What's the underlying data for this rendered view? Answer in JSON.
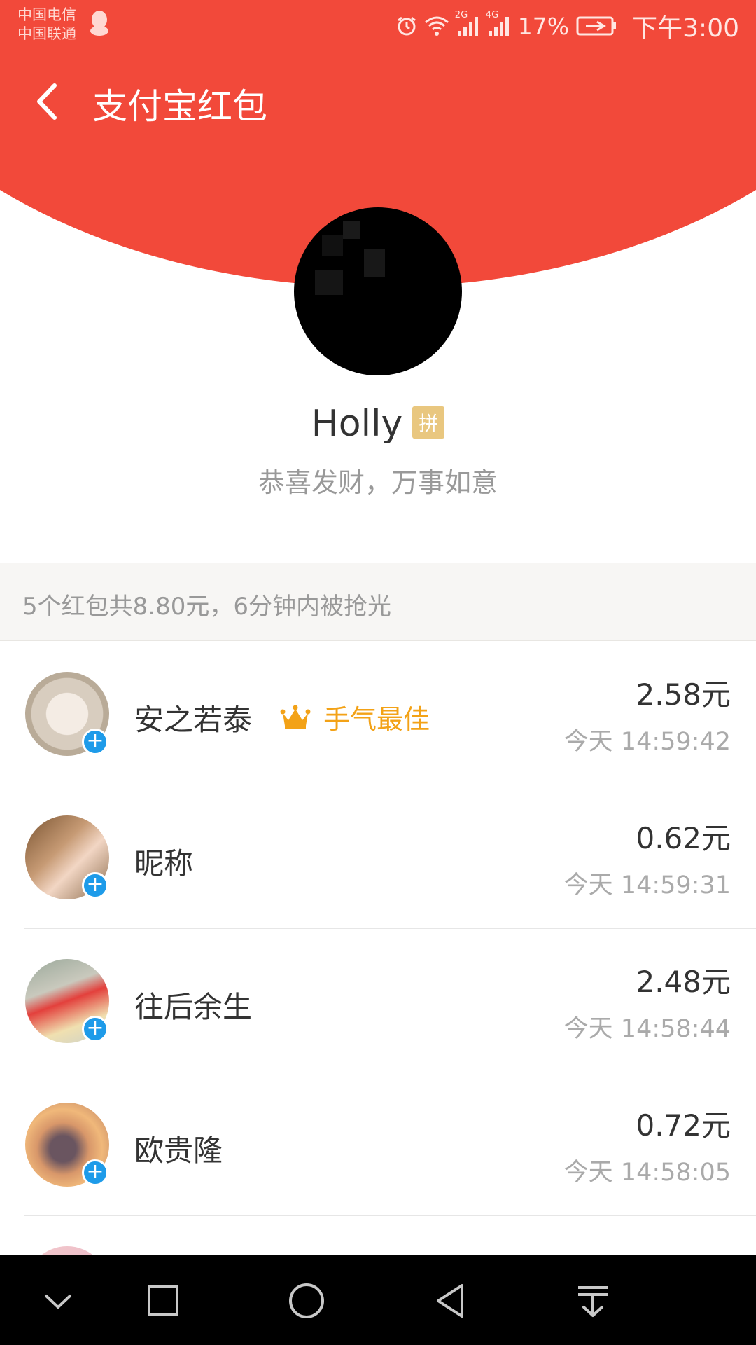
{
  "status_bar": {
    "carrier_1": "中国电信",
    "carrier_2": "中国联通",
    "net_2g": "2G",
    "net_4g": "4G",
    "battery": "17%",
    "time": "下午3:00"
  },
  "title_bar": {
    "title": "支付宝红包"
  },
  "sender": {
    "name": "Holly",
    "badge": "拼",
    "greeting": "恭喜发财，万事如意"
  },
  "summary": {
    "text": "5个红包共8.80元，6分钟内被抢光"
  },
  "recipients": [
    {
      "name": "安之若泰",
      "amount": "2.58元",
      "time": "今天 14:59:42",
      "best_label": "手气最佳"
    },
    {
      "name": "昵称",
      "amount": "0.62元",
      "time": "今天 14:59:31"
    },
    {
      "name": "往后余生",
      "amount": "2.48元",
      "time": "今天 14:58:44"
    },
    {
      "name": "欧贵隆",
      "amount": "0.72元",
      "time": "今天 14:58:05"
    }
  ],
  "add_badge_symbol": "+",
  "colors": {
    "header_red": "#f2493a",
    "best_gold": "#f3a217",
    "add_badge_blue": "#1e9be9",
    "pin_badge": "#e9c77f"
  },
  "icons": {
    "back": "chevron-left-icon",
    "crown": "crown-icon",
    "nav": [
      "chevron-down-icon",
      "square-icon",
      "circle-icon",
      "triangle-back-icon",
      "download-icon"
    ]
  }
}
